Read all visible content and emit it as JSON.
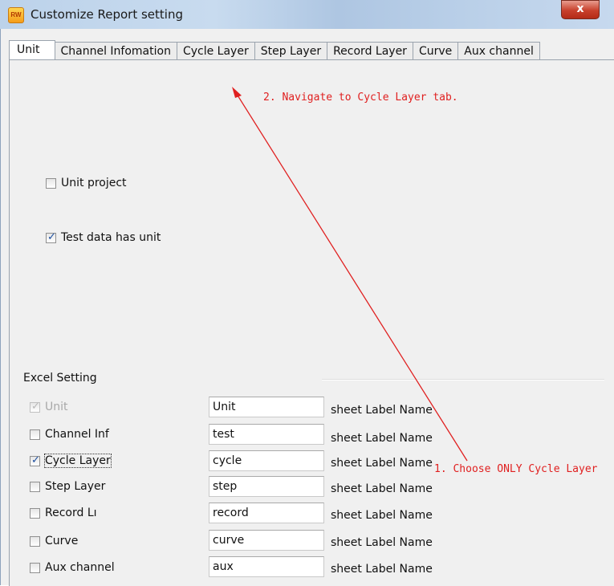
{
  "window": {
    "title": "Customize Report setting",
    "close_label": "x",
    "app_icon_text": "RW"
  },
  "tabs": [
    {
      "label": "Unit",
      "active": true
    },
    {
      "label": "Channel Infomation",
      "active": false
    },
    {
      "label": "Cycle Layer",
      "active": false
    },
    {
      "label": "Step Layer",
      "active": false
    },
    {
      "label": "Record Layer",
      "active": false
    },
    {
      "label": "Curve",
      "active": false
    },
    {
      "label": "Aux channel",
      "active": false
    }
  ],
  "unit_options": [
    {
      "label": "Unit project",
      "checked": false
    },
    {
      "label": "Test data has unit",
      "checked": true
    }
  ],
  "excel_setting": {
    "title": "Excel Setting",
    "sheet_label_text": "sheet Label Name",
    "rows": [
      {
        "label": "Unit",
        "checked": true,
        "disabled": true,
        "value": "Unit"
      },
      {
        "label": "Channel Inf",
        "checked": false,
        "disabled": false,
        "value": "test"
      },
      {
        "label": "Cycle Layer",
        "checked": true,
        "disabled": false,
        "value": "cycle"
      },
      {
        "label": "Step Layer",
        "checked": false,
        "disabled": false,
        "value": "step"
      },
      {
        "label": "Record Lı",
        "checked": false,
        "disabled": false,
        "value": "record"
      },
      {
        "label": "Curve",
        "checked": false,
        "disabled": false,
        "value": "curve"
      },
      {
        "label": "Aux channel",
        "checked": false,
        "disabled": false,
        "value": "aux"
      }
    ]
  },
  "annotations": {
    "step1": "1. Choose ONLY Cycle Layer",
    "step2": "2. Navigate to Cycle Layer tab.",
    "color": "#e02020"
  }
}
